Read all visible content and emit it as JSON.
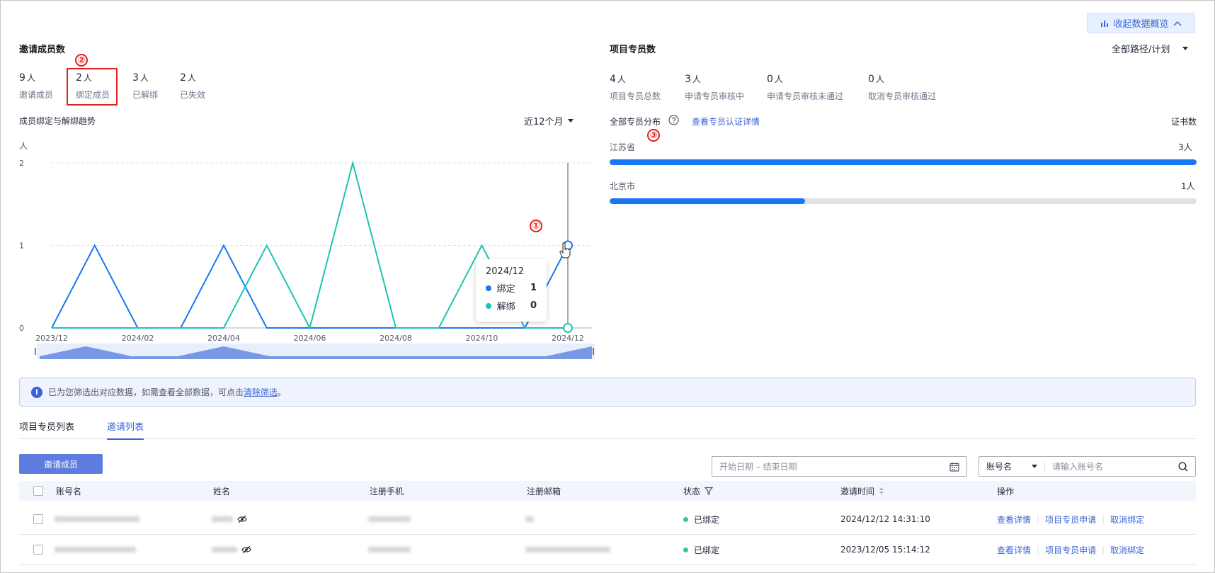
{
  "header": {
    "collapse_label": "收起数据概览"
  },
  "invite_panel": {
    "title": "邀请成员数",
    "stats": [
      {
        "num": "9",
        "unit": "人",
        "label": "邀请成员"
      },
      {
        "num": "2",
        "unit": "人",
        "label": "绑定成员"
      },
      {
        "num": "3",
        "unit": "人",
        "label": "已解绑"
      },
      {
        "num": "2",
        "unit": "人",
        "label": "已失效"
      }
    ],
    "trend_title": "成员绑定与解绑趋势",
    "range_label": "近12个月",
    "markers": {
      "one": "①",
      "two": "②",
      "three": "③"
    }
  },
  "chart_data": {
    "type": "line",
    "ylabel": "人",
    "ylim": [
      0,
      2
    ],
    "yticks": [
      "0",
      "1",
      "2"
    ],
    "x": [
      "2023/12",
      "2024/01",
      "2024/02",
      "2024/03",
      "2024/04",
      "2024/05",
      "2024/06",
      "2024/07",
      "2024/08",
      "2024/09",
      "2024/10",
      "2024/11",
      "2024/12"
    ],
    "xtick_labels": [
      "2023/12",
      "2024/02",
      "2024/04",
      "2024/06",
      "2024/08",
      "2024/10",
      "2024/12"
    ],
    "series": [
      {
        "name": "绑定",
        "color": "#1977f3",
        "values": [
          0,
          1,
          0,
          0,
          1,
          0,
          0,
          0,
          0,
          0,
          0,
          0,
          1
        ]
      },
      {
        "name": "解绑",
        "color": "#1fc3b0",
        "values": [
          0,
          0,
          0,
          0,
          0,
          1,
          0,
          2,
          0,
          0,
          1,
          0,
          0
        ]
      }
    ],
    "tooltip": {
      "title": "2024/12",
      "rows": [
        {
          "name": "绑定",
          "value": "1"
        },
        {
          "name": "解绑",
          "value": "0"
        }
      ]
    }
  },
  "expert_panel": {
    "title": "项目专员数",
    "path_select": "全部路径/计划",
    "stats": [
      {
        "num": "4",
        "unit": "人",
        "label": "项目专员总数"
      },
      {
        "num": "3",
        "unit": "人",
        "label": "申请专员审核中"
      },
      {
        "num": "0",
        "unit": "人",
        "label": "申请专员审核未通过"
      },
      {
        "num": "0",
        "unit": "人",
        "label": "取消专员审核通过"
      }
    ],
    "dist_title": "全部专员分布",
    "view_link": "查看专员认证详情",
    "cert_label": "证书数",
    "regions": [
      {
        "name": "江苏省",
        "count": "3人",
        "fraction": 1.0
      },
      {
        "name": "北京市",
        "count": "1人",
        "fraction": 0.333
      }
    ]
  },
  "info": {
    "text": "已为您筛选出对应数据，如需查看全部数据，可点击",
    "link": "清除筛选",
    "end": "。"
  },
  "tabs": [
    "项目专员列表",
    "邀请列表"
  ],
  "toolbar": {
    "invite_button": "邀请成员",
    "date_placeholder": "开始日期 – 结束日期",
    "filter_select": "账号名",
    "search_placeholder": "请输入账号名"
  },
  "table": {
    "columns": [
      "账号名",
      "姓名",
      "注册手机",
      "注册邮箱",
      "状态",
      "邀请时间",
      "操作"
    ],
    "rows": [
      {
        "status": "已绑定",
        "time": "2024/12/12 14:31:10"
      },
      {
        "status": "已绑定",
        "time": "2023/12/05 15:14:12"
      }
    ],
    "actions": [
      "查看详情",
      "项目专员申请",
      "取消绑定"
    ]
  }
}
